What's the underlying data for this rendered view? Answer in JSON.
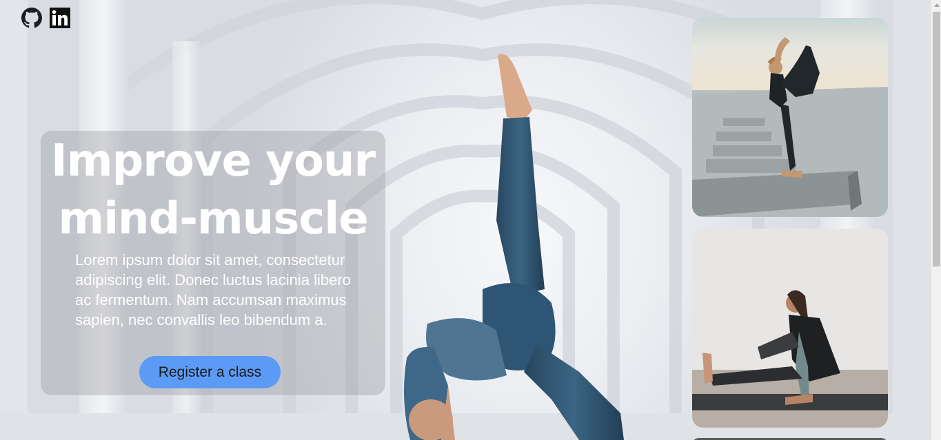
{
  "social": {
    "github_icon": "github-icon",
    "linkedin_icon": "linkedin-icon"
  },
  "hero": {
    "title": "Improve your mind-muscle",
    "description": "Lorem ipsum dolor sit amet, consectetur adipiscing elit. Donec luctus lacinia libero ac fermentum. Nam accumsan maximus sapien, nec convallis leo bibendum a.",
    "cta_label": "Register a class"
  },
  "colors": {
    "cta_background": "#5b9bf5",
    "hero_text": "#ffffff",
    "icon": "#1b1f23"
  }
}
